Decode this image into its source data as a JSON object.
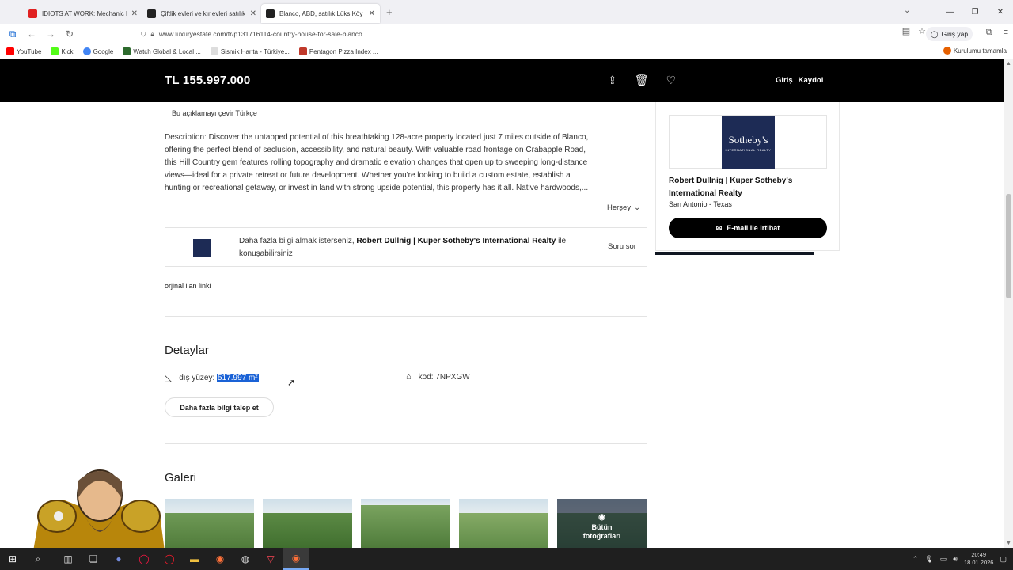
{
  "browser": {
    "tabs": [
      {
        "title": "IDIOTS AT WORK: Mechanic Ed",
        "color": "#e02020",
        "active": false
      },
      {
        "title": "Çiftlik evleri ve kır evleri satılık",
        "color": "#222222",
        "active": false
      },
      {
        "title": "Blanco, ABD, satılık Lüks Köy evi",
        "color": "#222222",
        "active": true
      }
    ],
    "url": "www.luxuryestate.com/tr/p131716114-country-house-for-sale-blanco",
    "account_label": "Giriş yap",
    "bookmarks": [
      {
        "label": "YouTube",
        "color": "#ff0000"
      },
      {
        "label": "Kick",
        "color": "#53fc18"
      },
      {
        "label": "Google",
        "color": "#4285f4"
      },
      {
        "label": "Watch Global & Local ...",
        "color": "#2d6a2d"
      },
      {
        "label": "Sismik Harita - Türkiye...",
        "color": "#888888"
      },
      {
        "label": "Pentagon Pizza Index ...",
        "color": "#c0392b"
      }
    ],
    "bookmark_right": "Kurulumu tamamla"
  },
  "header": {
    "price": "TL 155.997.000",
    "login": "Giriş",
    "register": "Kaydol"
  },
  "listing": {
    "translate_label": "Bu açıklamayı çevir Türkçe",
    "description_lines": [
      "Description: Discover the untapped potential of this breathtaking 128-acre property located just 7 miles outside of Blanco,",
      "offering the perfect blend of seclusion, accessibility, and natural beauty. With valuable road frontage on Crabapple Road,",
      "this Hill Country gem features rolling topography and dramatic elevation changes that open up to sweeping long-distance",
      "views—ideal for a private retreat or future development. Whether you're looking to build a custom estate, establish a",
      "hunting or recreational getaway, or invest in land with strong upside potential, this property has it all. Native hardwoods,..."
    ],
    "more_label": "Herşey",
    "contact_prefix": "Daha fazla bilgi almak isterseniz,",
    "contact_agent": "Robert Dullnig | Kuper Sotheby's International Realty",
    "contact_suffix": "ile",
    "contact_line2": "konuşabilirsiniz",
    "ask_label": "Soru sor",
    "original_link": "orjinal ilan linki"
  },
  "details": {
    "title": "Detaylar",
    "area_label": "dış yüzey:",
    "area_value": "517.997 m²",
    "code_label": "kod: 7NPXGW",
    "request_button": "Daha fazla bilgi talep et"
  },
  "gallery": {
    "title": "Galeri",
    "all_photos_line1": "Bütün",
    "all_photos_line2": "fotoğrafları"
  },
  "agent_card": {
    "logo_text": "Sotheby's",
    "logo_sub": "INTERNATIONAL REALTY",
    "name": "Robert Dullnig | Kuper Sotheby's International Realty",
    "location": "San Antonio - Texas",
    "email_button": "E-mail ile irtibat"
  },
  "taskbar": {
    "time": "20:49",
    "date": "18.01.2026"
  }
}
